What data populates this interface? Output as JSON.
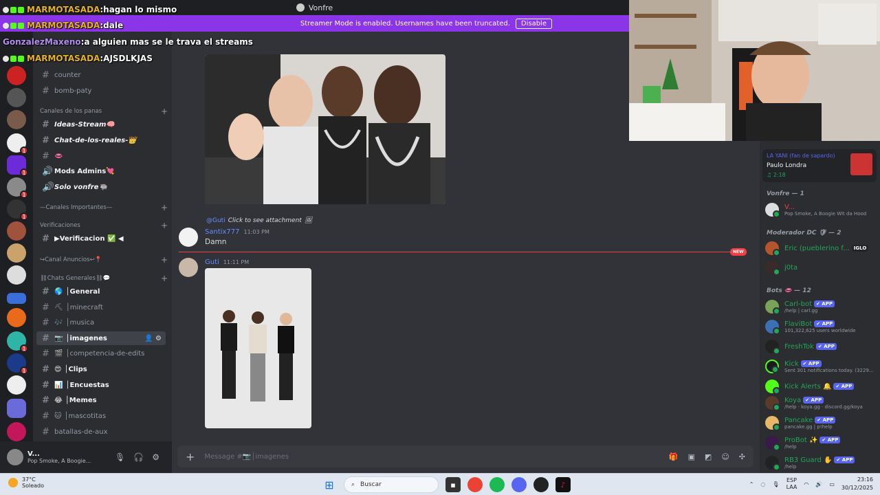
{
  "window": {
    "title": "Vonfre"
  },
  "banner": {
    "text": "Streamer Mode is enabled. Usernames have been truncated.",
    "button": "Disable"
  },
  "overlay_chat": [
    {
      "user": "MARMOTASADA",
      "sep": " : ",
      "msg": "hagan lo mismo"
    },
    {
      "user": "MARMOTASADA",
      "sep": " : ",
      "msg": "dale"
    },
    {
      "user": "GonzalezMaxeno",
      "sep": " : ",
      "msg": "a alguien mas se le trava el streams"
    },
    {
      "user": "MARMOTASADA",
      "sep": " : ",
      "msg": "AJSDLKJAS"
    }
  ],
  "channels": {
    "items": [
      {
        "label": "counter"
      },
      {
        "label": "bomb-paty"
      },
      {
        "category": "Canales de los panas"
      },
      {
        "label": "Ideas-Stream",
        "icon": "🧠"
      },
      {
        "label": "Chat-de-los-reales-",
        "icon": "👑"
      },
      {
        "label": "",
        "icon": "👄"
      },
      {
        "label": "Mods Admins",
        "icon": "💘"
      },
      {
        "label": "Solo vonfre",
        "icon": "🐃"
      },
      {
        "category": "—Canales Importantes—"
      },
      {
        "category": "Verificaciones"
      },
      {
        "label": "▶Verificacion ✅ ◀"
      },
      {
        "category": "↪Canal Anuncios↩📍"
      },
      {
        "category": "⛓Chats Generales⛓💬"
      },
      {
        "label": "│General",
        "icon": "🌎"
      },
      {
        "label": "│minecraft",
        "icon": "⛏"
      },
      {
        "label": "│musica",
        "icon": "🎶"
      },
      {
        "label": "│imagenes",
        "icon": "📷"
      },
      {
        "label": "│competencia-de-edits",
        "icon": "🎬"
      },
      {
        "label": "│Clips",
        "icon": "😍"
      },
      {
        "label": "│Encuestas",
        "icon": "📊"
      },
      {
        "label": "│Memes",
        "icon": "😂"
      },
      {
        "label": "│mascotitas",
        "icon": "🐱"
      },
      {
        "label": "batallas-de-aux"
      }
    ]
  },
  "user_panel": {
    "name": "V...",
    "status": "Pop Smoke, A Boogie..."
  },
  "messages": {
    "reply_user": "@Guti",
    "reply_text": "Click to see attachment",
    "m1_author": "Santix777",
    "m1_time": "11:03 PM",
    "m1_text": "Damn",
    "new_label": "NEW",
    "m2_author": "Guti",
    "m2_time": "11:11 PM"
  },
  "composer": {
    "placeholder": "Message #📷│imagenes"
  },
  "now_playing": {
    "label": "LA YANI (fan de sapardo)",
    "song": "Paulo Londra",
    "time": "♫ 2:18"
  },
  "member_groups": {
    "vonfre": "Vonfre — 1",
    "mods": "Moderador DC 🛡 — 2",
    "bots": "Bots 👄 — 12"
  },
  "members": [
    {
      "name": "V...",
      "status": "Pop Smoke, A Boogie Wit da Hood",
      "color": "#f23f43"
    },
    {
      "name": "Eric (pueblerino f...",
      "tag": "IGLO",
      "color": "#23a55a"
    },
    {
      "name": "j0ta",
      "color": "#23a55a"
    },
    {
      "name": "Carl-bot",
      "status": "/help | carl.gg"
    },
    {
      "name": "FlaviBot",
      "status": "101,322,625 users worldwide"
    },
    {
      "name": "FreshTok",
      "status": ""
    },
    {
      "name": "Kick",
      "status": "Sent 301 notifications today. (3229..."
    },
    {
      "name": "Kick Alerts 🔔",
      "status": ""
    },
    {
      "name": "Koya",
      "status": "/help · koya.gg · discord.gg/koya"
    },
    {
      "name": "Pancake",
      "status": "pancake.gg | p!help"
    },
    {
      "name": "ProBot ✨",
      "status": "/help"
    },
    {
      "name": "RB3 Guard ✋",
      "status": "/help"
    }
  ],
  "app_tag": "✔ APP",
  "taskbar": {
    "temp": "37°C",
    "weather": "Soleado",
    "search": "Buscar",
    "lang1": "ESP",
    "lang2": "LAA",
    "time": "23:16",
    "date": "30/12/2025"
  }
}
